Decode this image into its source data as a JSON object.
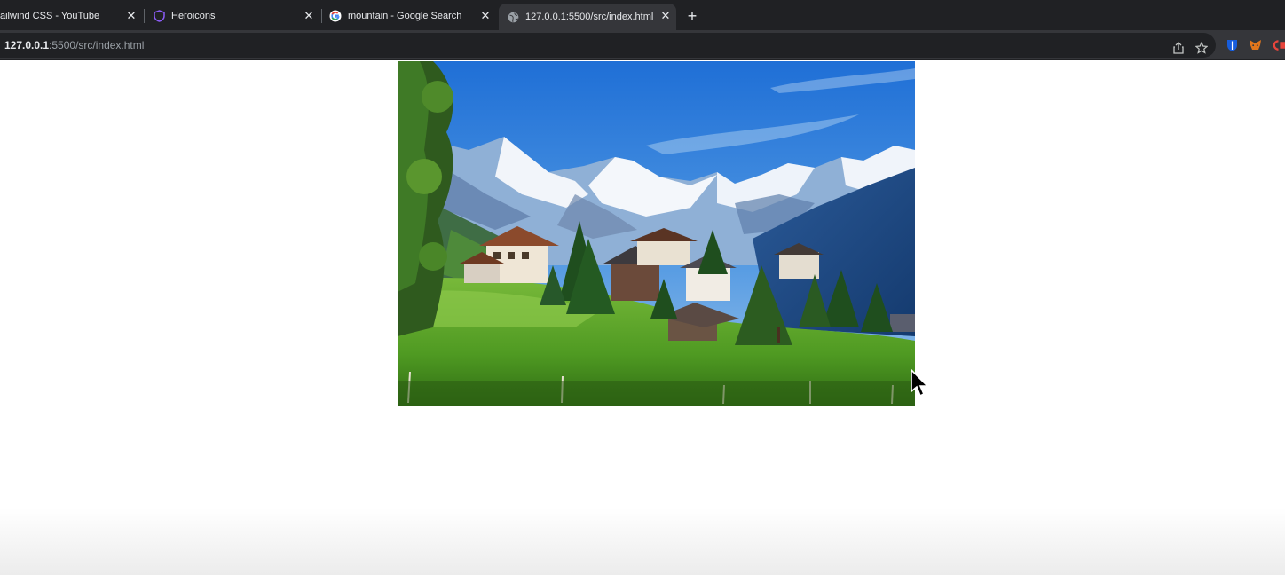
{
  "browser": {
    "tabs": [
      {
        "title": "ailwind CSS - YouTube",
        "icon": "youtube-icon"
      },
      {
        "title": "Heroicons",
        "icon": "shield-icon"
      },
      {
        "title": "mountain - Google Search",
        "icon": "google-icon"
      },
      {
        "title": "127.0.0.1:5500/src/index.html",
        "icon": "globe-icon",
        "active": true
      }
    ],
    "close_glyph": "✕",
    "new_tab_glyph": "+",
    "url_host": "127.0.0.1",
    "url_rest": ":5500/src/index.html",
    "toolbar_icons": [
      "share-icon",
      "star-icon",
      "bitwarden-icon",
      "metamask-icon",
      "extension-icon"
    ]
  },
  "page": {
    "image": {
      "description_icon": "mountain-village-image"
    }
  },
  "colors": {
    "tab_bar": "#202124",
    "toolbar": "#35363a",
    "text": "#e8eaed",
    "heroicons_purple": "#8b5cf6"
  }
}
